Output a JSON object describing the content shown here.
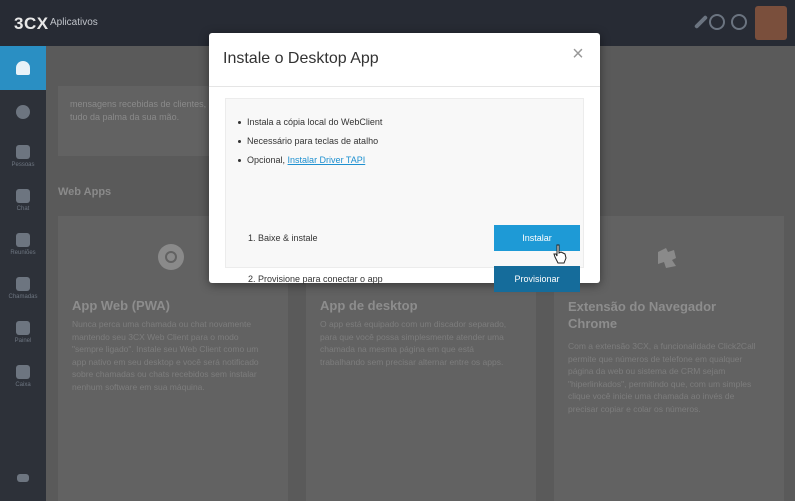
{
  "topbar": {
    "brand": "3CX",
    "app_label": "Aplicativos"
  },
  "sidebar": {
    "items": [
      {
        "icon": "bell-icon",
        "label": ""
      },
      {
        "icon": "user-icon",
        "label": ""
      },
      {
        "icon": "people-icon",
        "label": "Pessoas"
      },
      {
        "icon": "chat-icon",
        "label": "Chat"
      },
      {
        "icon": "calendar-icon",
        "label": "Reuniões"
      },
      {
        "icon": "phone-icon",
        "label": "Chamadas"
      },
      {
        "icon": "presence-icon",
        "label": "Painel"
      },
      {
        "icon": "voicemail-icon",
        "label": "Caixa"
      }
    ]
  },
  "main": {
    "top_text": "mensagens recebidas de clientes, mas, tudo da palma da sua mão.",
    "section_title": "Web Apps",
    "cards": [
      {
        "icon": "chrome-icon",
        "title": "App Web (PWA)",
        "description": "Nunca perca uma chamada ou chat novamente mantendo seu 3CX Web Client para o modo \"sempre ligado\". Instale seu Web Client como um app nativo em seu desktop e você será notificado sobre chamadas ou chats recebidos sem instalar nenhum software em sua máquina."
      },
      {
        "icon": "",
        "title": "App de desktop",
        "description": "O app está equipado com um discador separado, para que você possa simplesmente atender uma chamada na mesma página em que está trabalhando sem precisar alternar entre os apps."
      },
      {
        "icon": "puzzle-icon",
        "title": "Extensão do Navegador Chrome",
        "description": "Com a extensão 3CX, a funcionalidade Click2Call permite que números de telefone em qualquer página da web ou sistema de CRM sejam \"hiperlinkados\", permitindo que, com um simples clique você inicie uma chamada ao invés de precisar copiar e colar os números."
      }
    ]
  },
  "modal": {
    "title": "Instale o Desktop App",
    "close_symbol": "×",
    "bullets": [
      "Instala a cópia local do WebClient",
      "Necessário para teclas de atalho"
    ],
    "optional_prefix": "Opcional,",
    "tapi_link": "Instalar Driver TAPI",
    "step1": "1. Baixe & instale",
    "step2": "2. Provisione para conectar o app",
    "install_button": "Instalar",
    "provision_button": "Provisionar"
  },
  "colors": {
    "accent": "#1e9ad6",
    "accent_dark": "#156c9b",
    "topbar": "#272b34",
    "sidebar": "#2d3139",
    "sidebar_active": "#2a8fc3"
  }
}
